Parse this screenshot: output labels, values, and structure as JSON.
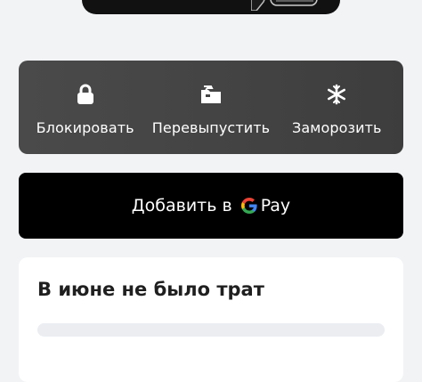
{
  "actions": [
    {
      "label": "Блокировать",
      "icon": "lock-icon"
    },
    {
      "label": "Перевыпустить",
      "icon": "reissue-card-icon"
    },
    {
      "label": "Заморозить",
      "icon": "snowflake-icon"
    }
  ],
  "gpay": {
    "label": "Добавить в",
    "pay": "Pay",
    "logo": "google-g-icon"
  },
  "spending": {
    "title": "В июне не было трат",
    "progress": 0
  },
  "colors": {
    "panel": "#444444",
    "gpay_background": "#000000",
    "page_background": "#f2f3f5",
    "bar_background": "#ebedf1",
    "google_blue": "#4285F4",
    "google_red": "#EA4335",
    "google_yellow": "#FBBC05",
    "google_green": "#34A853"
  }
}
